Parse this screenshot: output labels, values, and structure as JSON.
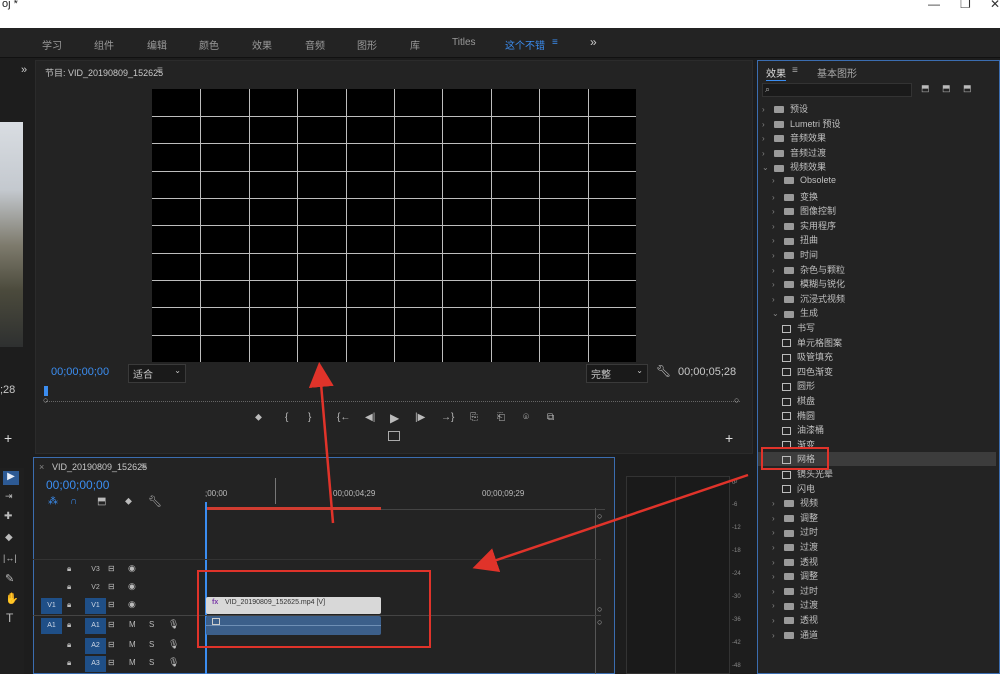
{
  "window": {
    "title": "oj *",
    "min": "—",
    "restore": "❐",
    "close": "✕"
  },
  "workspaces": [
    {
      "label": "学习",
      "active": false
    },
    {
      "label": "组件",
      "active": false
    },
    {
      "label": "编辑",
      "active": false
    },
    {
      "label": "颜色",
      "active": false
    },
    {
      "label": "效果",
      "active": false
    },
    {
      "label": "音频",
      "active": false
    },
    {
      "label": "图形",
      "active": false
    },
    {
      "label": "库",
      "active": false
    },
    {
      "label": "Titles",
      "active": false
    },
    {
      "label": "这个不错",
      "active": true
    }
  ],
  "ws_menu": "≡",
  "ws_more": "»",
  "left": {
    "more": "»",
    "tc": ";28",
    "add": "+"
  },
  "program": {
    "title": "节目: VID_20190809_152625",
    "menu": "≡",
    "timecode": "00;00;00;00",
    "fit": "适合",
    "quality": "完整",
    "duration": "00;00;05;28",
    "add": "+"
  },
  "transport": [
    "⬥",
    "{",
    "}",
    "{←",
    "◀|",
    "▶",
    "|▶",
    "→}",
    "⎘",
    "⎗",
    "⌾",
    "⧉"
  ],
  "timeline": {
    "close": "×",
    "title": "VID_20190809_152625",
    "menu": "≡",
    "timecode": "00;00;00;00",
    "ruler": [
      ";00;00",
      "00;00;04;29",
      "00;00;09;29"
    ],
    "tracks": [
      {
        "name": "V3",
        "src": "",
        "kind": "video"
      },
      {
        "name": "V2",
        "src": "",
        "kind": "video"
      },
      {
        "name": "V1",
        "src": "V1",
        "kind": "video"
      },
      {
        "name": "A1",
        "src": "A1",
        "kind": "audio"
      },
      {
        "name": "A2",
        "src": "",
        "kind": "audio"
      },
      {
        "name": "A3",
        "src": "",
        "kind": "audio"
      }
    ],
    "clip": "VID_20190809_152625.mp4 [V]",
    "fx": "fx",
    "mute": "M",
    "solo": "S"
  },
  "meter": {
    "labels": [
      "0",
      "-6",
      "-12",
      "-18",
      "-24",
      "-30",
      "-36",
      "-42",
      "-48"
    ]
  },
  "effects": {
    "tab1": "效果",
    "tab1menu": "≡",
    "tab2": "基本图形",
    "search_placeholder": "",
    "items": [
      {
        "label": "预设",
        "level": 0,
        "type": "folder",
        "open": false
      },
      {
        "label": "Lumetri 预设",
        "level": 0,
        "type": "folder",
        "open": false
      },
      {
        "label": "音频效果",
        "level": 0,
        "type": "folder",
        "open": false
      },
      {
        "label": "音频过渡",
        "level": 0,
        "type": "folder",
        "open": false
      },
      {
        "label": "视频效果",
        "level": 0,
        "type": "folder",
        "open": true
      },
      {
        "label": "Obsolete",
        "level": 1,
        "type": "folder",
        "open": false
      },
      {
        "label": "变换",
        "level": 1,
        "type": "folder",
        "open": false
      },
      {
        "label": "图像控制",
        "level": 1,
        "type": "folder",
        "open": false
      },
      {
        "label": "实用程序",
        "level": 1,
        "type": "folder",
        "open": false
      },
      {
        "label": "扭曲",
        "level": 1,
        "type": "folder",
        "open": false
      },
      {
        "label": "时间",
        "level": 1,
        "type": "folder",
        "open": false
      },
      {
        "label": "杂色与颗粒",
        "level": 1,
        "type": "folder",
        "open": false
      },
      {
        "label": "模糊与锐化",
        "level": 1,
        "type": "folder",
        "open": false
      },
      {
        "label": "沉浸式视频",
        "level": 1,
        "type": "folder",
        "open": false
      },
      {
        "label": "生成",
        "level": 1,
        "type": "folder",
        "open": true
      },
      {
        "label": "书写",
        "level": 2,
        "type": "effect"
      },
      {
        "label": "单元格图案",
        "level": 2,
        "type": "effect"
      },
      {
        "label": "吸管填充",
        "level": 2,
        "type": "effect"
      },
      {
        "label": "四色渐变",
        "level": 2,
        "type": "effect"
      },
      {
        "label": "圆形",
        "level": 2,
        "type": "effect"
      },
      {
        "label": "棋盘",
        "level": 2,
        "type": "effect"
      },
      {
        "label": "椭圆",
        "level": 2,
        "type": "effect"
      },
      {
        "label": "油漆桶",
        "level": 2,
        "type": "effect"
      },
      {
        "label": "渐变",
        "level": 2,
        "type": "effect"
      },
      {
        "label": "网格",
        "level": 2,
        "type": "effect",
        "selected": true
      },
      {
        "label": "镜头光晕",
        "level": 2,
        "type": "effect"
      },
      {
        "label": "闪电",
        "level": 2,
        "type": "effect"
      },
      {
        "label": "视频",
        "level": 1,
        "type": "folder",
        "open": false
      },
      {
        "label": "调整",
        "level": 1,
        "type": "folder",
        "open": false
      },
      {
        "label": "过时",
        "level": 1,
        "type": "folder",
        "open": false
      },
      {
        "label": "过渡",
        "level": 1,
        "type": "folder",
        "open": false
      },
      {
        "label": "透视",
        "level": 1,
        "type": "folder",
        "open": false
      },
      {
        "label": "调整",
        "level": 1,
        "type": "folder",
        "open": false
      },
      {
        "label": "过时",
        "level": 1,
        "type": "folder",
        "open": false
      },
      {
        "label": "过渡",
        "level": 1,
        "type": "folder",
        "open": false
      },
      {
        "label": "透视",
        "level": 1,
        "type": "folder",
        "open": false
      },
      {
        "label": "通道",
        "level": 1,
        "type": "folder",
        "open": false
      }
    ]
  },
  "colors": {
    "accent": "#3b8df0",
    "highlight": "#e0332a",
    "track_target": "#1f4f87"
  }
}
